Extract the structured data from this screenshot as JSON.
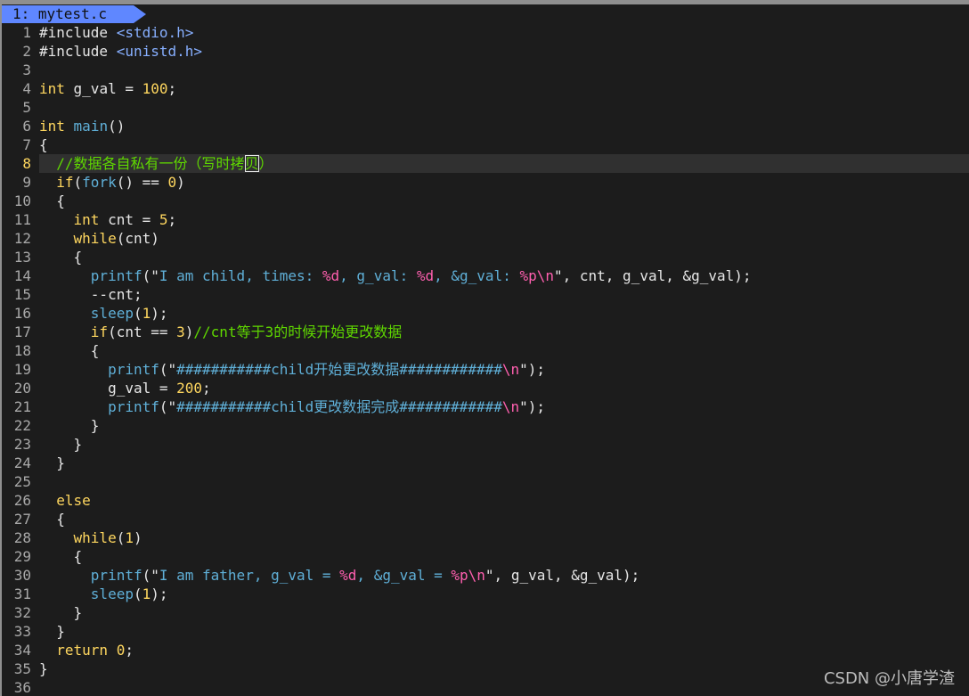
{
  "tab": {
    "label": "1: mytest.c"
  },
  "cursor_line": 8,
  "colors": {
    "background": "#1c1c1c",
    "tab": "#5f87ff",
    "keyword": "#ffd75f",
    "function": "#5fafd7",
    "format_spec": "#ff5faf",
    "comment": "#5fd700",
    "line_number": "#a8a8a8"
  },
  "lines": [
    {
      "num": "1",
      "tokens": [
        [
          "pre",
          "#include "
        ],
        [
          "header",
          "<stdio.h>"
        ]
      ]
    },
    {
      "num": "2",
      "tokens": [
        [
          "pre",
          "#include "
        ],
        [
          "header",
          "<unistd.h>"
        ]
      ]
    },
    {
      "num": "3",
      "tokens": []
    },
    {
      "num": "4",
      "tokens": [
        [
          "type",
          "int"
        ],
        [
          "plain",
          " g_val = "
        ],
        [
          "num",
          "100"
        ],
        [
          "plain",
          ";"
        ]
      ]
    },
    {
      "num": "5",
      "tokens": []
    },
    {
      "num": "6",
      "tokens": [
        [
          "type",
          "int"
        ],
        [
          "plain",
          " "
        ],
        [
          "func",
          "main"
        ],
        [
          "plain",
          "()"
        ]
      ]
    },
    {
      "num": "7",
      "tokens": [
        [
          "plain",
          "{"
        ]
      ]
    },
    {
      "num": "8",
      "tokens": [
        [
          "plain",
          "  "
        ],
        [
          "comment",
          "//数据各自私有一份（写时拷"
        ],
        [
          "cursor",
          "贝"
        ],
        [
          "comment",
          "）"
        ]
      ]
    },
    {
      "num": "9",
      "tokens": [
        [
          "plain",
          "  "
        ],
        [
          "ctrl",
          "if"
        ],
        [
          "plain",
          "("
        ],
        [
          "func",
          "fork"
        ],
        [
          "plain",
          "() == "
        ],
        [
          "num",
          "0"
        ],
        [
          "plain",
          ")"
        ]
      ]
    },
    {
      "num": "10",
      "tokens": [
        [
          "plain",
          "  {"
        ]
      ]
    },
    {
      "num": "11",
      "tokens": [
        [
          "plain",
          "    "
        ],
        [
          "type",
          "int"
        ],
        [
          "plain",
          " cnt = "
        ],
        [
          "num",
          "5"
        ],
        [
          "plain",
          ";"
        ]
      ]
    },
    {
      "num": "12",
      "tokens": [
        [
          "plain",
          "    "
        ],
        [
          "ctrl",
          "while"
        ],
        [
          "plain",
          "(cnt)"
        ]
      ]
    },
    {
      "num": "13",
      "tokens": [
        [
          "plain",
          "    {"
        ]
      ]
    },
    {
      "num": "14",
      "tokens": [
        [
          "plain",
          "      "
        ],
        [
          "func",
          "printf"
        ],
        [
          "plain",
          "(\""
        ],
        [
          "string",
          "I am child, times: "
        ],
        [
          "fmt",
          "%d"
        ],
        [
          "string",
          ", g_val: "
        ],
        [
          "fmt",
          "%d"
        ],
        [
          "string",
          ", &g_val: "
        ],
        [
          "fmt",
          "%p\\n"
        ],
        [
          "plain",
          "\", cnt, g_val, &g_val);"
        ]
      ]
    },
    {
      "num": "15",
      "tokens": [
        [
          "plain",
          "      --cnt;"
        ]
      ]
    },
    {
      "num": "16",
      "tokens": [
        [
          "plain",
          "      "
        ],
        [
          "func",
          "sleep"
        ],
        [
          "plain",
          "("
        ],
        [
          "num",
          "1"
        ],
        [
          "plain",
          ");"
        ]
      ]
    },
    {
      "num": "17",
      "tokens": [
        [
          "plain",
          "      "
        ],
        [
          "ctrl",
          "if"
        ],
        [
          "plain",
          "(cnt == "
        ],
        [
          "num",
          "3"
        ],
        [
          "plain",
          ")"
        ],
        [
          "comment",
          "//cnt等于3的时候开始更改数据"
        ]
      ]
    },
    {
      "num": "18",
      "tokens": [
        [
          "plain",
          "      {"
        ]
      ]
    },
    {
      "num": "19",
      "tokens": [
        [
          "plain",
          "        "
        ],
        [
          "func",
          "printf"
        ],
        [
          "plain",
          "(\""
        ],
        [
          "string",
          "###########child开始更改数据############"
        ],
        [
          "fmt",
          "\\n"
        ],
        [
          "plain",
          "\");"
        ]
      ]
    },
    {
      "num": "20",
      "tokens": [
        [
          "plain",
          "        g_val = "
        ],
        [
          "num",
          "200"
        ],
        [
          "plain",
          ";"
        ]
      ]
    },
    {
      "num": "21",
      "tokens": [
        [
          "plain",
          "        "
        ],
        [
          "func",
          "printf"
        ],
        [
          "plain",
          "(\""
        ],
        [
          "string",
          "###########child更改数据完成############"
        ],
        [
          "fmt",
          "\\n"
        ],
        [
          "plain",
          "\");"
        ]
      ]
    },
    {
      "num": "22",
      "tokens": [
        [
          "plain",
          "      }"
        ]
      ]
    },
    {
      "num": "23",
      "tokens": [
        [
          "plain",
          "    }"
        ]
      ]
    },
    {
      "num": "24",
      "tokens": [
        [
          "plain",
          "  }"
        ]
      ]
    },
    {
      "num": "25",
      "tokens": []
    },
    {
      "num": "26",
      "tokens": [
        [
          "plain",
          "  "
        ],
        [
          "ctrl",
          "else"
        ]
      ]
    },
    {
      "num": "27",
      "tokens": [
        [
          "plain",
          "  {"
        ]
      ]
    },
    {
      "num": "28",
      "tokens": [
        [
          "plain",
          "    "
        ],
        [
          "ctrl",
          "while"
        ],
        [
          "plain",
          "("
        ],
        [
          "num",
          "1"
        ],
        [
          "plain",
          ")"
        ]
      ]
    },
    {
      "num": "29",
      "tokens": [
        [
          "plain",
          "    {"
        ]
      ]
    },
    {
      "num": "30",
      "tokens": [
        [
          "plain",
          "      "
        ],
        [
          "func",
          "printf"
        ],
        [
          "plain",
          "(\""
        ],
        [
          "string",
          "I am father, g_val = "
        ],
        [
          "fmt",
          "%d"
        ],
        [
          "string",
          ", &g_val = "
        ],
        [
          "fmt",
          "%p\\n"
        ],
        [
          "plain",
          "\", g_val, &g_val);"
        ]
      ]
    },
    {
      "num": "31",
      "tokens": [
        [
          "plain",
          "      "
        ],
        [
          "func",
          "sleep"
        ],
        [
          "plain",
          "("
        ],
        [
          "num",
          "1"
        ],
        [
          "plain",
          ");"
        ]
      ]
    },
    {
      "num": "32",
      "tokens": [
        [
          "plain",
          "    }"
        ]
      ]
    },
    {
      "num": "33",
      "tokens": [
        [
          "plain",
          "  }"
        ]
      ]
    },
    {
      "num": "34",
      "tokens": [
        [
          "plain",
          "  "
        ],
        [
          "keyword",
          "return"
        ],
        [
          "plain",
          " "
        ],
        [
          "num",
          "0"
        ],
        [
          "plain",
          ";"
        ]
      ]
    },
    {
      "num": "35",
      "tokens": [
        [
          "plain",
          "}"
        ]
      ]
    },
    {
      "num": "36",
      "tokens": []
    }
  ],
  "watermark": "CSDN @小唐学渣"
}
